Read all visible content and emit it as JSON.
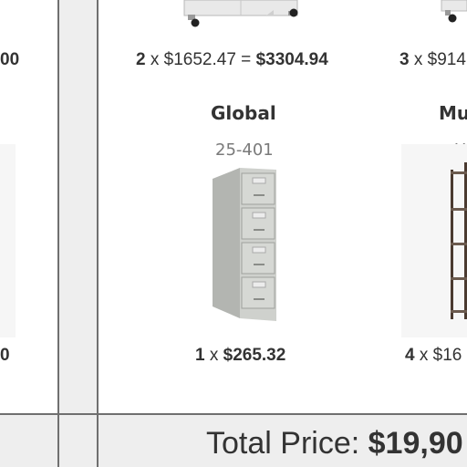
{
  "left_partial": {
    "price_suffix": "00",
    "bottom_suffix": "0"
  },
  "products": [
    {
      "qty": "2",
      "times": "x",
      "unit_price": "$1652.47",
      "equals": "=",
      "line_total": "$3304.94",
      "icon": "mobile-cabinet-image"
    },
    {
      "name": "Global",
      "sku": "25-401",
      "qty": "1",
      "times": "x",
      "unit_price": "$265.32",
      "icon": "filing-cabinet-image"
    }
  ],
  "right_partial": {
    "top_price": {
      "qty": "3",
      "times": "x",
      "unit_price": "$914"
    },
    "name": "Mu",
    "sku": "U",
    "bottom_price": {
      "qty": "4",
      "times": "x",
      "unit_price": "$16"
    },
    "icon": "shelving-unit-image"
  },
  "footer": {
    "total_label": "Total Price:",
    "total_value": "$19,90"
  },
  "colors": {
    "background": "#ffffff",
    "panel": "#eeeeee",
    "border": "#6f6f6f",
    "text": "#333333",
    "muted": "#7a7a7a"
  }
}
